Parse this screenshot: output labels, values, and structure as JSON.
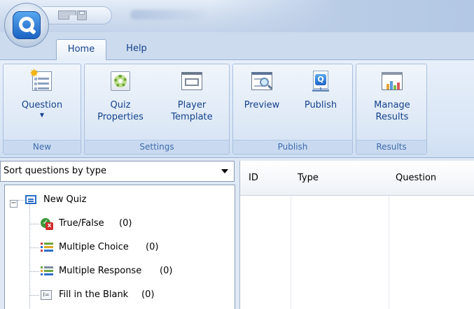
{
  "tabs": [
    {
      "label": "Home"
    },
    {
      "label": "Help"
    }
  ],
  "ribbon": {
    "groups": [
      {
        "label": "New",
        "buttons": [
          {
            "label": "Question",
            "icon": "question-icon"
          }
        ]
      },
      {
        "label": "Settings",
        "buttons": [
          {
            "label": "Quiz Properties",
            "icon": "gear-icon"
          },
          {
            "label": "Player Template",
            "icon": "template-icon"
          }
        ]
      },
      {
        "label": "Publish",
        "buttons": [
          {
            "label": "Preview",
            "icon": "preview-icon"
          },
          {
            "label": "Publish",
            "icon": "publish-icon"
          }
        ]
      },
      {
        "label": "Results",
        "buttons": [
          {
            "label": "Manage Results",
            "icon": "results-icon"
          }
        ]
      }
    ]
  },
  "sort": {
    "selected": "Sort questions by type"
  },
  "tree": {
    "root": {
      "label": "New Quiz",
      "icon": "quiz-icon"
    },
    "items": [
      {
        "label": "True/False",
        "count": "(0)",
        "icon": "true-false-icon"
      },
      {
        "label": "Multiple Choice",
        "count": "(0)",
        "icon": "multiple-choice-icon"
      },
      {
        "label": "Multiple Response",
        "count": "(0)",
        "icon": "multiple-response-icon"
      },
      {
        "label": "Fill in the Blank",
        "count": "(0)",
        "icon": "fill-blank-icon"
      }
    ]
  },
  "grid": {
    "columns": [
      "ID",
      "Type",
      "Question"
    ]
  },
  "colors": {
    "accent": "#15428b",
    "ribbon": "#dde8f6",
    "tab_text": "#15428b"
  }
}
